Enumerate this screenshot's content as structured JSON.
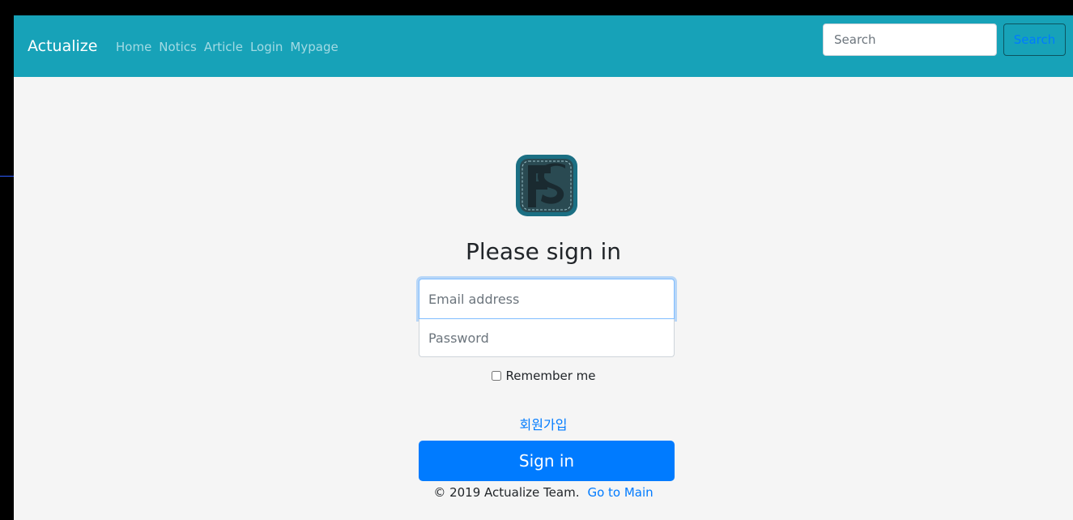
{
  "navbar": {
    "brand": "Actualize",
    "links": [
      "Home",
      "Notics",
      "Article",
      "Login",
      "Mypage"
    ],
    "search": {
      "placeholder": "Search",
      "button_label": "Search"
    }
  },
  "logo": {
    "icon": "fs-logo-icon",
    "colors": {
      "frame": "#1b6f83",
      "inner": "#2a4a52",
      "letter": "#1a2a30",
      "stitch": "#9fc4cc"
    }
  },
  "form": {
    "heading": "Please sign in",
    "email": {
      "placeholder": "Email address"
    },
    "password": {
      "placeholder": "Password"
    },
    "remember_label": "Remember me",
    "signup_link": "회원가입",
    "submit_label": "Sign in"
  },
  "footer": {
    "copyright": "© 2019 Actualize Team.",
    "main_link": "Go to Main"
  },
  "colors": {
    "navbar": "#17a2b8",
    "primary": "#007bff",
    "background": "#f5f5f5"
  }
}
